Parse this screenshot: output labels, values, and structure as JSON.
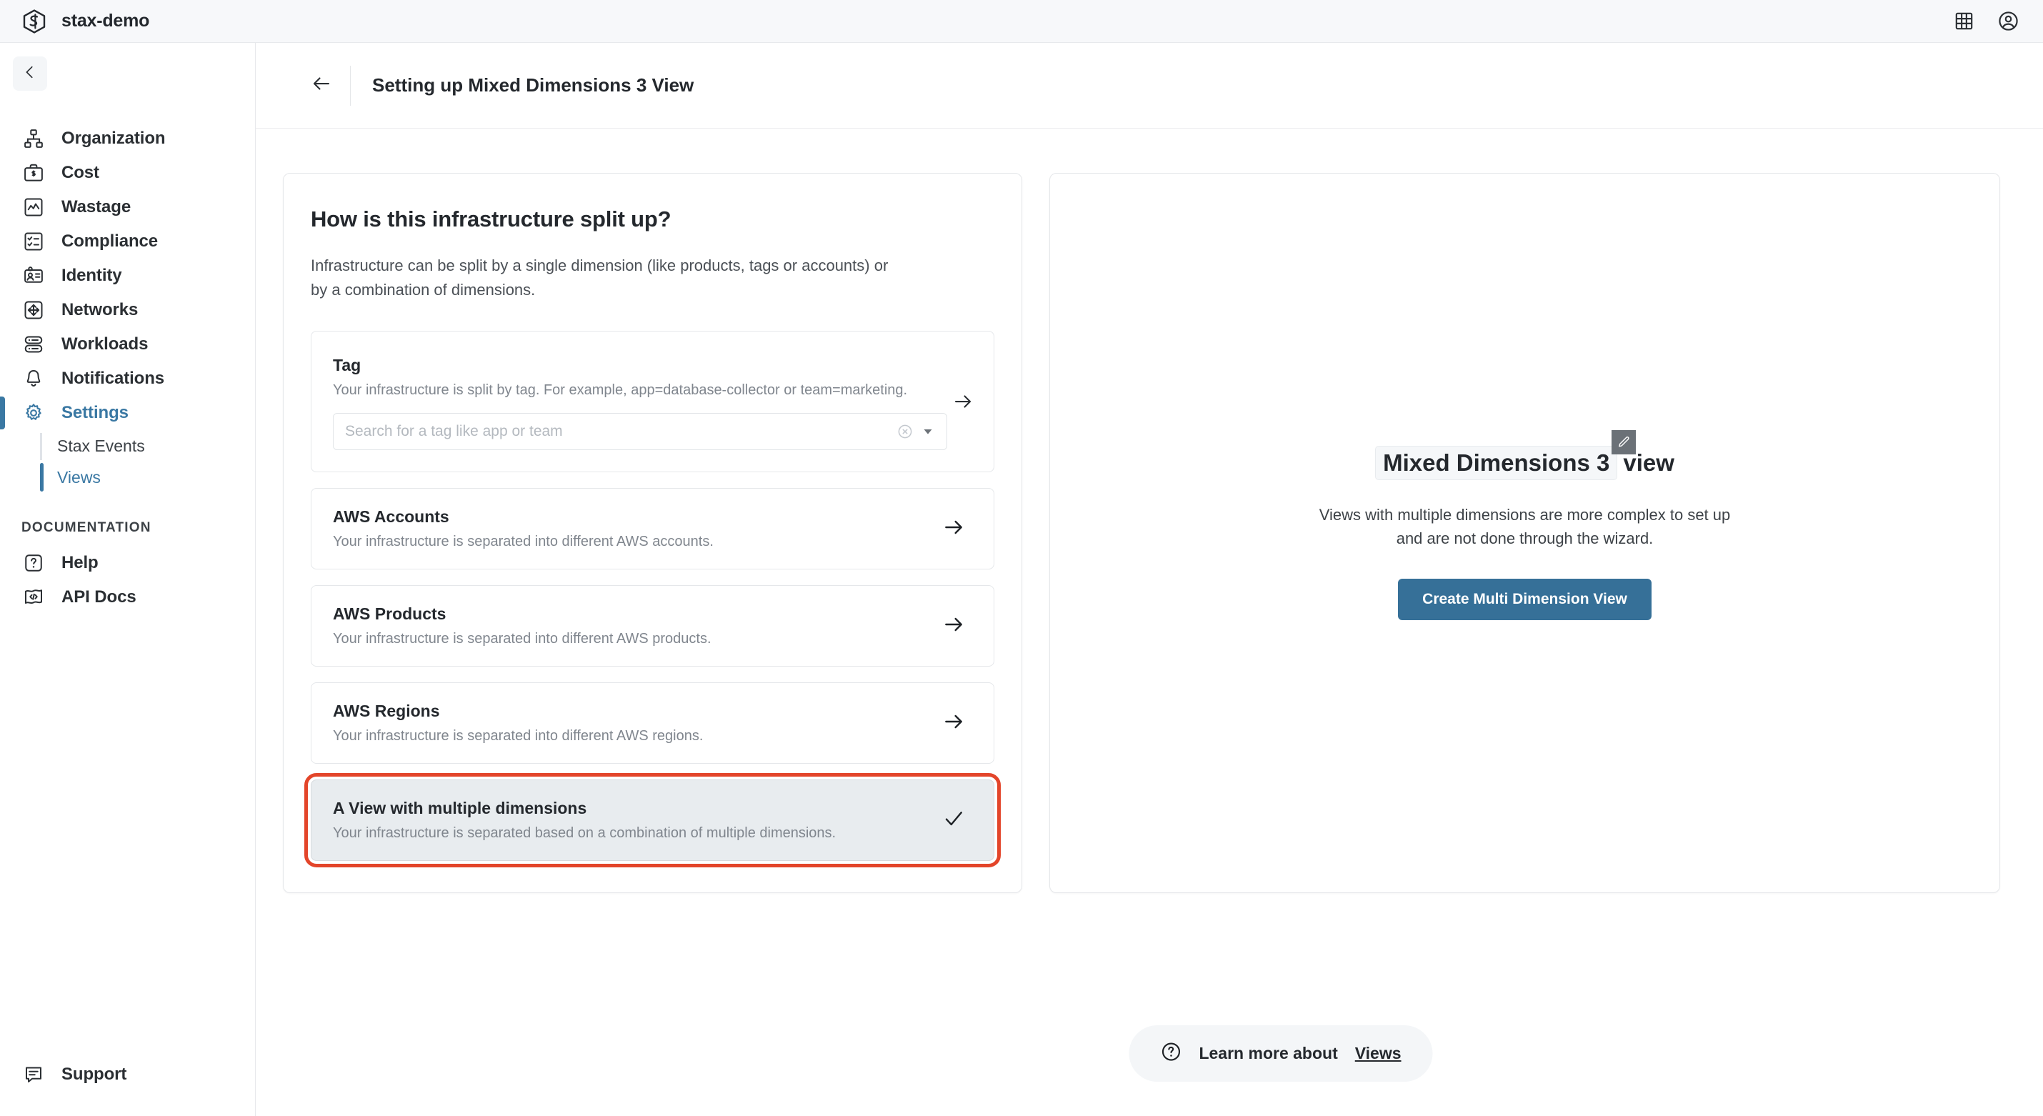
{
  "topbar": {
    "brand_name": "stax-demo",
    "logo_icon": "stax-hexagon-logo",
    "apps_icon": "grid-apps-icon",
    "account_icon": "user-account-icon"
  },
  "sidebar": {
    "collapse_icon": "chevron-left-icon",
    "items": [
      {
        "label": "Organization",
        "icon": "org-chart-icon",
        "active": false
      },
      {
        "label": "Cost",
        "icon": "briefcase-dollar-icon",
        "active": false
      },
      {
        "label": "Wastage",
        "icon": "chart-line-icon",
        "active": false
      },
      {
        "label": "Compliance",
        "icon": "checklist-icon",
        "active": false
      },
      {
        "label": "Identity",
        "icon": "id-card-icon",
        "active": false
      },
      {
        "label": "Networks",
        "icon": "arrows-move-icon",
        "active": false
      },
      {
        "label": "Workloads",
        "icon": "server-stack-icon",
        "active": false
      },
      {
        "label": "Notifications",
        "icon": "bell-icon",
        "active": false
      },
      {
        "label": "Settings",
        "icon": "gear-icon",
        "active": true
      }
    ],
    "sub_items": [
      {
        "label": "Stax Events",
        "active": false
      },
      {
        "label": "Views",
        "active": true
      }
    ],
    "documentation_heading": "DOCUMENTATION",
    "doc_items": [
      {
        "label": "Help",
        "icon": "question-box-icon"
      },
      {
        "label": "API Docs",
        "icon": "code-flag-icon"
      }
    ],
    "support": {
      "label": "Support",
      "icon": "chat-bubble-icon"
    }
  },
  "page": {
    "back_icon": "arrow-left-icon",
    "title": "Setting up Mixed Dimensions 3 View"
  },
  "left_panel": {
    "heading": "How is this infrastructure split up?",
    "description": "Infrastructure can be split by a single dimension (like products, tags or accounts) or by a combination of dimensions.",
    "tag_card": {
      "title": "Tag",
      "description": "Your infrastructure is split by tag. For example, app=database-collector or team=marketing.",
      "input_value": "",
      "input_placeholder": "Search for a tag like app or team",
      "clear_icon": "clear-circle-icon",
      "caret_icon": "chevron-down-icon",
      "arrow_icon": "arrow-right-icon"
    },
    "options": [
      {
        "title": "AWS Accounts",
        "description": "Your infrastructure is separated into different AWS accounts.",
        "icon": "arrow-right-icon",
        "selected": false
      },
      {
        "title": "AWS Products",
        "description": "Your infrastructure is separated into different AWS products.",
        "icon": "arrow-right-icon",
        "selected": false
      },
      {
        "title": "AWS Regions",
        "description": "Your infrastructure is separated into different AWS regions.",
        "icon": "arrow-right-icon",
        "selected": false
      },
      {
        "title": "A View with multiple dimensions",
        "description": "Your infrastructure is separated based on a combination of multiple dimensions.",
        "icon": "check-icon",
        "selected": true
      }
    ]
  },
  "right_panel": {
    "title_chip": "Mixed Dimensions 3",
    "title_suffix": "view",
    "edit_icon": "pencil-icon",
    "description": "Views with multiple dimensions are more complex to set up and are not done through the wizard.",
    "button_label": "Create Multi Dimension View"
  },
  "footer": {
    "help_icon": "question-circle-icon",
    "text": "Learn more about",
    "link": "Views"
  },
  "colors": {
    "accent_blue": "#3a78a3",
    "button_blue": "#367098",
    "highlight_red": "#e3452a",
    "selected_card_bg": "#e8ecef",
    "topbar_bg": "#f7f8fa",
    "text_primary": "#24282d",
    "text_muted": "#80868e"
  }
}
